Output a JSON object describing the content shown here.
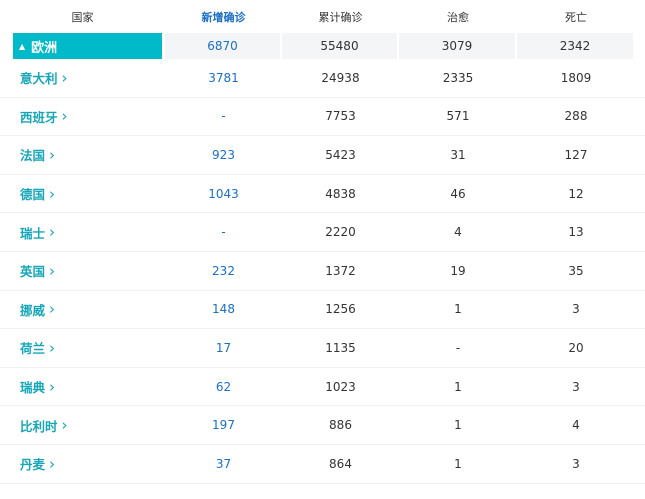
{
  "columns": {
    "country": "国家",
    "new": "新增确诊",
    "total": "累计确诊",
    "cured": "治愈",
    "dead": "死亡"
  },
  "region": {
    "name": "欧洲",
    "new": "6870",
    "total": "55480",
    "cured": "3079",
    "dead": "2342"
  },
  "rows": [
    {
      "country": "意大利",
      "new": "3781",
      "total": "24938",
      "cured": "2335",
      "dead": "1809"
    },
    {
      "country": "西班牙",
      "new": "-",
      "total": "7753",
      "cured": "571",
      "dead": "288"
    },
    {
      "country": "法国",
      "new": "923",
      "total": "5423",
      "cured": "31",
      "dead": "127"
    },
    {
      "country": "德国",
      "new": "1043",
      "total": "4838",
      "cured": "46",
      "dead": "12"
    },
    {
      "country": "瑞士",
      "new": "-",
      "total": "2220",
      "cured": "4",
      "dead": "13"
    },
    {
      "country": "英国",
      "new": "232",
      "total": "1372",
      "cured": "19",
      "dead": "35"
    },
    {
      "country": "挪威",
      "new": "148",
      "total": "1256",
      "cured": "1",
      "dead": "3"
    },
    {
      "country": "荷兰",
      "new": "17",
      "total": "1135",
      "cured": "-",
      "dead": "20"
    },
    {
      "country": "瑞典",
      "new": "62",
      "total": "1023",
      "cured": "1",
      "dead": "3"
    },
    {
      "country": "比利时",
      "new": "197",
      "total": "886",
      "cured": "1",
      "dead": "4"
    },
    {
      "country": "丹麦",
      "new": "37",
      "total": "864",
      "cured": "1",
      "dead": "3"
    }
  ],
  "icons": {
    "collapse": "triangle-up-icon",
    "expand": "chevron-right-icon"
  },
  "colors": {
    "accent": "#00b9c9",
    "link": "#17a6b8",
    "new_count": "#1a6fc7"
  }
}
